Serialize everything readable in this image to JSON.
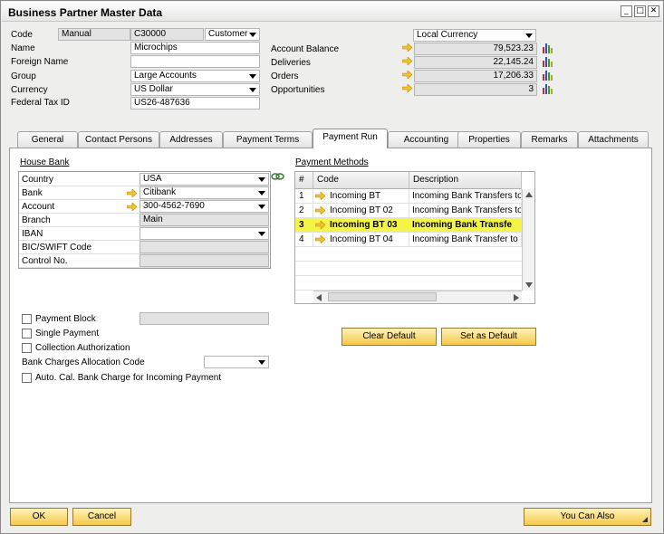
{
  "window": {
    "title": "Business Partner Master Data"
  },
  "header": {
    "code_label": "Code",
    "code_series": "Manual",
    "code_value": "C30000",
    "type_value": "Customer",
    "name_label": "Name",
    "name_value": "Microchips",
    "foreign_name_label": "Foreign Name",
    "foreign_name_value": "",
    "group_label": "Group",
    "group_value": "Large Accounts",
    "currency_label": "Currency",
    "currency_value": "US Dollar",
    "tax_label": "Federal Tax ID",
    "tax_value": "US26-487636",
    "currency_mode": "Local Currency",
    "account_balance_label": "Account Balance",
    "account_balance_value": "79,523.23",
    "deliveries_label": "Deliveries",
    "deliveries_value": "22,145.24",
    "orders_label": "Orders",
    "orders_value": "17,206.33",
    "opportunities_label": "Opportunities",
    "opportunities_value": "3"
  },
  "tabs": [
    {
      "label": "General"
    },
    {
      "label": "Contact Persons"
    },
    {
      "label": "Addresses"
    },
    {
      "label": "Payment Terms"
    },
    {
      "label": "Payment Run"
    },
    {
      "label": "Accounting"
    },
    {
      "label": "Properties"
    },
    {
      "label": "Remarks"
    },
    {
      "label": "Attachments"
    }
  ],
  "house_bank": {
    "title": "House Bank",
    "country_label": "Country",
    "country_value": "USA",
    "bank_label": "Bank",
    "bank_value": "Citibank",
    "account_label": "Account",
    "account_value": "300-4562-7690",
    "branch_label": "Branch",
    "branch_value": "Main",
    "iban_label": "IBAN",
    "iban_value": "",
    "bic_label": "BIC/SWIFT Code",
    "bic_value": "",
    "control_label": "Control No.",
    "control_value": ""
  },
  "payment_methods": {
    "title": "Payment Methods",
    "col_num": "#",
    "col_code": "Code",
    "col_desc": "Description",
    "rows": [
      {
        "num": "1",
        "code": "Incoming BT",
        "desc": "Incoming Bank Transfers to"
      },
      {
        "num": "2",
        "code": "Incoming BT 02",
        "desc": "Incoming Bank Transfers to"
      },
      {
        "num": "3",
        "code": "Incoming BT 03",
        "desc": "Incoming Bank Transfe"
      },
      {
        "num": "4",
        "code": "Incoming BT 04",
        "desc": "Incoming Bank Transfer to"
      }
    ],
    "clear_default": "Clear Default",
    "set_default": "Set as Default"
  },
  "options": {
    "payment_block": "Payment Block",
    "single_payment": "Single Payment",
    "collection_auth": "Collection Authorization",
    "bank_charges_label": "Bank Charges Allocation Code",
    "bank_charges_value": "",
    "auto_cal": "Auto. Cal. Bank Charge for Incoming Payment"
  },
  "footer": {
    "ok": "OK",
    "cancel": "Cancel",
    "you_can_also": "You Can Also"
  },
  "colors": {
    "selected_row": "#f5f547",
    "button": "#f6c84a",
    "link_arrow": "#f2c230"
  }
}
